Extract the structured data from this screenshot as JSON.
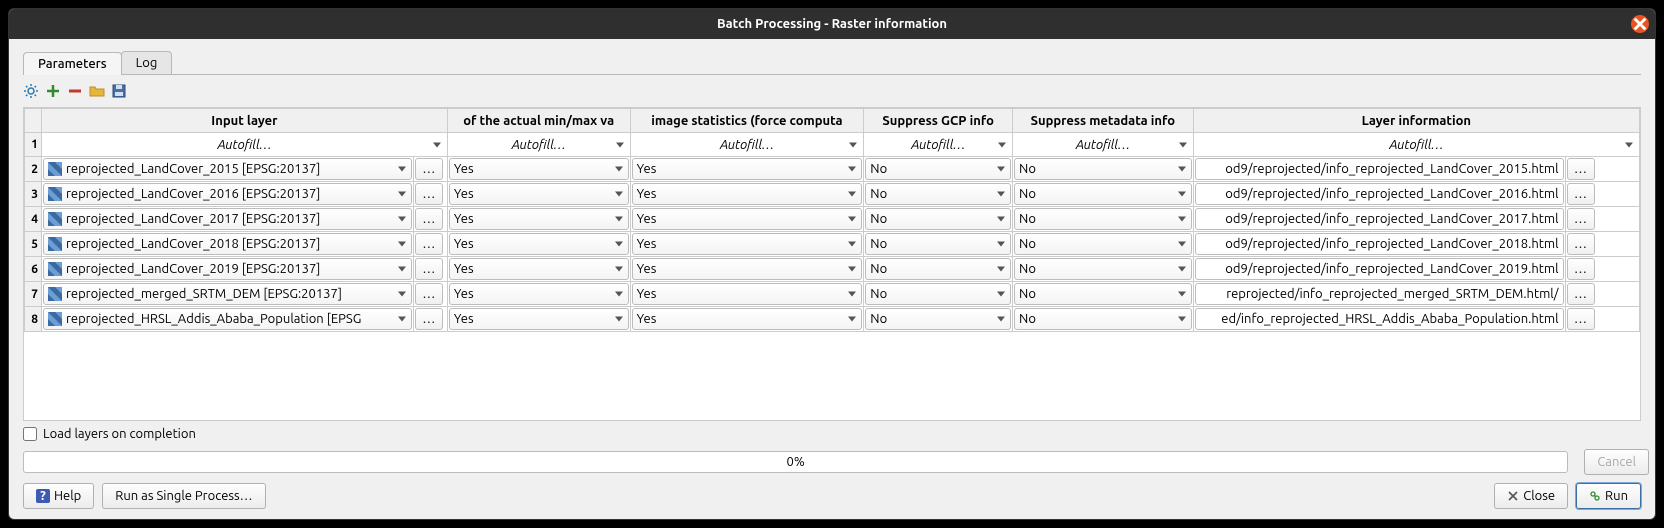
{
  "window": {
    "title": "Batch Processing - Raster information"
  },
  "tabs": {
    "parameters": "Parameters",
    "log": "Log"
  },
  "columns": {
    "input": "Input layer",
    "minmax": "of the actual min/max va",
    "stats": "image statistics (force computa",
    "gcp": "Suppress GCP info",
    "meta": "Suppress metadata info",
    "layerinfo": "Layer information"
  },
  "autofill": "Autofill…",
  "ellipsis": "…",
  "rows": [
    {
      "n": "2",
      "layer": "reprojected_LandCover_2015 [EPSG:20137]",
      "minmax": "Yes",
      "stats": "Yes",
      "gcp": "No",
      "meta": "No",
      "out": "od9/reprojected/info_reprojected_LandCover_2015.html"
    },
    {
      "n": "3",
      "layer": "reprojected_LandCover_2016 [EPSG:20137]",
      "minmax": "Yes",
      "stats": "Yes",
      "gcp": "No",
      "meta": "No",
      "out": "od9/reprojected/info_reprojected_LandCover_2016.html"
    },
    {
      "n": "4",
      "layer": "reprojected_LandCover_2017 [EPSG:20137]",
      "minmax": "Yes",
      "stats": "Yes",
      "gcp": "No",
      "meta": "No",
      "out": "od9/reprojected/info_reprojected_LandCover_2017.html"
    },
    {
      "n": "5",
      "layer": "reprojected_LandCover_2018 [EPSG:20137]",
      "minmax": "Yes",
      "stats": "Yes",
      "gcp": "No",
      "meta": "No",
      "out": "od9/reprojected/info_reprojected_LandCover_2018.html"
    },
    {
      "n": "6",
      "layer": "reprojected_LandCover_2019 [EPSG:20137]",
      "minmax": "Yes",
      "stats": "Yes",
      "gcp": "No",
      "meta": "No",
      "out": "od9/reprojected/info_reprojected_LandCover_2019.html"
    },
    {
      "n": "7",
      "layer": "reprojected_merged_SRTM_DEM [EPSG:20137]",
      "minmax": "Yes",
      "stats": "Yes",
      "gcp": "No",
      "meta": "No",
      "out": "/reprojected/info_reprojected_merged_SRTM_DEM.html"
    },
    {
      "n": "8",
      "layer": "reprojected_HRSL_Addis_Ababa_Population [EPSG",
      "minmax": "Yes",
      "stats": "Yes",
      "gcp": "No",
      "meta": "No",
      "out": "ed/info_reprojected_HRSL_Addis_Ababa_Population.html"
    }
  ],
  "first_row_num": "1",
  "footer": {
    "load_layers": "Load layers on completion",
    "progress": "0%",
    "help": "Help",
    "single": "Run as Single Process…",
    "cancel": "Cancel",
    "close": "Close",
    "run": "Run"
  }
}
